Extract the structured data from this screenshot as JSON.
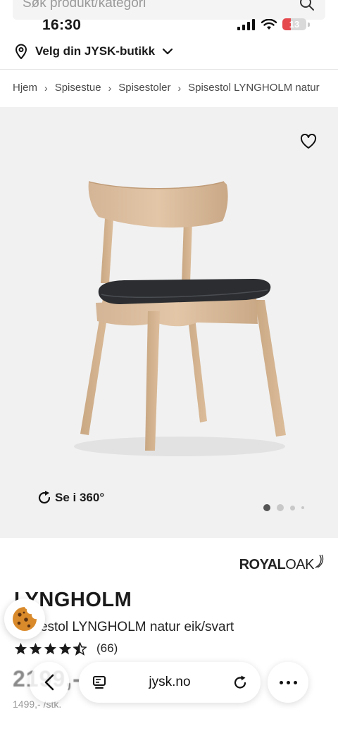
{
  "search": {
    "placeholder": "Søk produkt/kategori"
  },
  "status": {
    "time": "16:30",
    "battery": "13"
  },
  "store": {
    "label": "Velg din JYSK-butikk"
  },
  "breadcrumb": [
    "Hjem",
    "Spisestue",
    "Spisestoler",
    "Spisestol LYNGHOLM natur"
  ],
  "gallery": {
    "spin_label": "Se i 360°",
    "pages": 4,
    "active_page": 1
  },
  "brand": {
    "name_bold": "ROYAL",
    "name_light": "OAK"
  },
  "product": {
    "name": "LYNGHOLM",
    "subtitle": "Spisestol LYNGHOLM natur eik/svart",
    "rating": 4.5,
    "review_count": "(66)",
    "price": "2199,-",
    "price_before": "1499,- /stk."
  },
  "browser": {
    "url": "jysk.no"
  },
  "colors": {
    "gallery_bg": "#f1f1f1",
    "star": "#1a1a1a",
    "battery_low": "#e5484d"
  },
  "icons": [
    "search-icon",
    "location-pin-icon",
    "chevron-down-icon",
    "heart-icon",
    "rotate-360-icon",
    "cookie-icon",
    "back-arrow-icon",
    "tabs-icon",
    "reload-icon",
    "more-icon"
  ]
}
